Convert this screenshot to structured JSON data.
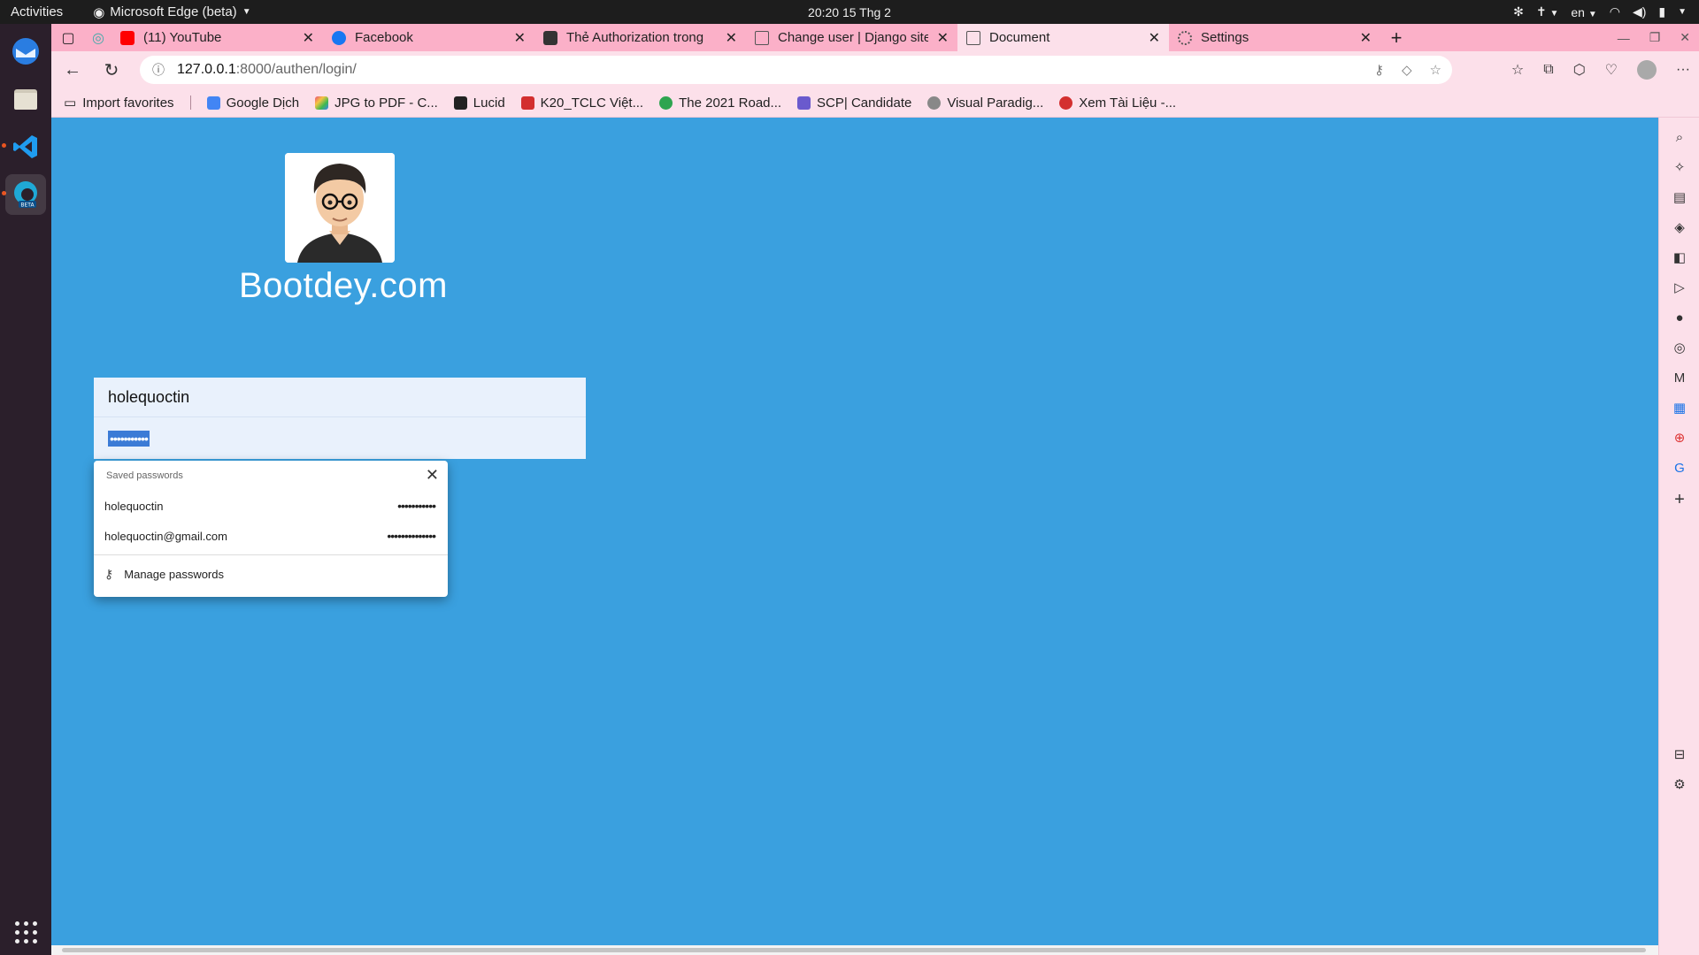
{
  "topbar": {
    "activities": "Activities",
    "app_name": "Microsoft Edge (beta)",
    "clock": "20:20  15 Thg 2",
    "lang": "en"
  },
  "tabs": [
    {
      "title": "(11) YouTube",
      "icon_color": "#ff0000"
    },
    {
      "title": "Facebook",
      "icon_color": "#1877f2"
    },
    {
      "title": "Thẻ Authorization trong",
      "icon_color": "#333333"
    },
    {
      "title": "Change user | Django site",
      "icon_color": "#777777"
    },
    {
      "title": "Document",
      "icon_color": "#777777",
      "active": true
    },
    {
      "title": "Settings",
      "icon_color": "#777777"
    }
  ],
  "address": {
    "host": "127.0.0.1",
    "path": ":8000/authen/login/"
  },
  "favorites": [
    {
      "label": "Import favorites",
      "icon_color": "#444444"
    },
    {
      "label": "Google Dịch",
      "icon_color": "#4285f4"
    },
    {
      "label": "JPG to PDF - C...",
      "icon_color": "#e94e77"
    },
    {
      "label": "Lucid",
      "icon_color": "#222222"
    },
    {
      "label": "K20_TCLC Việt...",
      "icon_color": "#d32f2f"
    },
    {
      "label": "The 2021 Road...",
      "icon_color": "#2ea44f"
    },
    {
      "label": "SCP| Candidate",
      "icon_color": "#6a5acd"
    },
    {
      "label": "Visual Paradig...",
      "icon_color": "#888888"
    },
    {
      "label": "Xem Tài Liệu -...",
      "icon_color": "#d32f2f"
    }
  ],
  "page": {
    "brand": "Bootdey.com",
    "username_value": "holequoctin",
    "password_mask": "•••••••••••"
  },
  "password_popup": {
    "header": "Saved passwords",
    "entries": [
      {
        "user": "holequoctin",
        "mask": "•••••••••••"
      },
      {
        "user": "holequoctin@gmail.com",
        "mask": "••••••••••••••"
      }
    ],
    "manage": "Manage passwords"
  },
  "colors": {
    "page_bg": "#3aa0df",
    "browser_chrome": "#fce0ea",
    "tabstrip": "#fbb0c8",
    "selection": "#3b7bd6"
  }
}
